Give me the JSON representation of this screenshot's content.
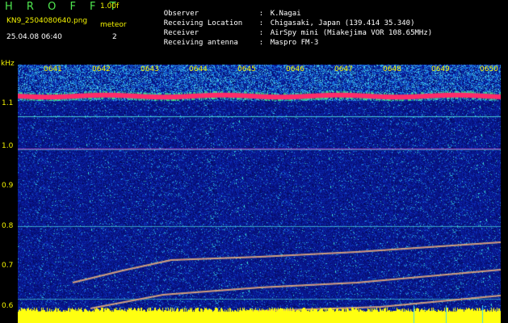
{
  "header": {
    "app_title": "H R O F F T",
    "version": "1.00f",
    "file_name": "KN9_2504080640.png",
    "meteor_label": "meteor",
    "timestamp": "25.04.08 06:40",
    "meteor_count": "2"
  },
  "station_info": [
    {
      "key": "Observer",
      "value": "K.Nagai"
    },
    {
      "key": "Receiving Location",
      "value": "Chigasaki, Japan (139.414 35.340)"
    },
    {
      "key": "Receiver",
      "value": "AirSpy mini (Miakejima VOR 108.65MHz)"
    },
    {
      "key": "Receiving antenna",
      "value": "Maspro FM-3"
    }
  ],
  "axis": {
    "y_unit": "kHz",
    "y_ticks": [
      "1.1",
      "1.0",
      "0.9",
      "0.8",
      "0.7",
      "0.6"
    ],
    "x_ticks": [
      "0641",
      "0642",
      "0643",
      "0644",
      "0645",
      "0646",
      "0647",
      "0648",
      "0649",
      "0650"
    ]
  },
  "colors": {
    "label_yellow": "#f3f300",
    "title_green": "#4fe74f",
    "background_blue": "#0a1a8c",
    "carrier_red": "#ff2060",
    "noise_floor_yellow": "#ffff00"
  }
}
